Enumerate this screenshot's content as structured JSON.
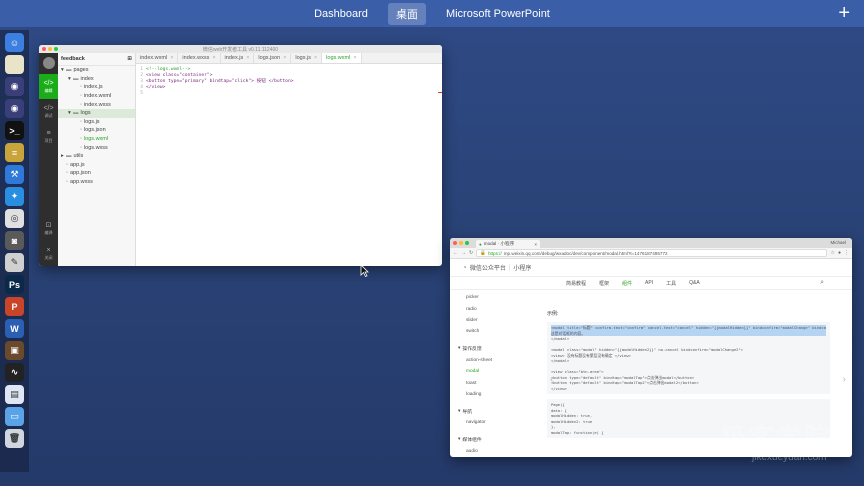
{
  "mission_control": {
    "spaces": [
      "Dashboard",
      "桌面",
      "Microsoft PowerPoint"
    ],
    "active_space_index": 1,
    "add_space_label": "+"
  },
  "dock": {
    "icons": [
      {
        "name": "finder-icon",
        "color": "#3d7fe0",
        "glyph": "☺"
      },
      {
        "name": "notes-icon",
        "color": "#e9e3c8",
        "glyph": ""
      },
      {
        "name": "eclipse-icon",
        "color": "#3a3f7a",
        "glyph": "◉"
      },
      {
        "name": "eclipse-icon-2",
        "color": "#3a3f7a",
        "glyph": "◉"
      },
      {
        "name": "terminal-icon",
        "color": "#111111",
        "glyph": ">_"
      },
      {
        "name": "database-icon",
        "color": "#c9a43a",
        "glyph": "≡"
      },
      {
        "name": "xcode-icon",
        "color": "#2f79d8",
        "glyph": "⚒"
      },
      {
        "name": "safari-icon",
        "color": "#2a8ee0",
        "glyph": "✦"
      },
      {
        "name": "chrome-icon",
        "color": "#e0e0e0",
        "glyph": "◎"
      },
      {
        "name": "photo-booth-icon",
        "color": "#5a5a5a",
        "glyph": "◙"
      },
      {
        "name": "pencil-icon",
        "color": "#d0d0d0",
        "glyph": "✎"
      },
      {
        "name": "photoshop-icon",
        "color": "#0b2a4a",
        "glyph": "Ps"
      },
      {
        "name": "powerpoint-icon",
        "color": "#c9452a",
        "glyph": "P"
      },
      {
        "name": "word-icon",
        "color": "#2b5fb4",
        "glyph": "W"
      },
      {
        "name": "image-app-icon",
        "color": "#6a4a2a",
        "glyph": "▣"
      },
      {
        "name": "activity-monitor-icon",
        "color": "#222222",
        "glyph": "∿"
      },
      {
        "name": "preview-icon",
        "color": "#dfe7f5",
        "glyph": "▤"
      },
      {
        "name": "folder-icon",
        "color": "#5aa3e8",
        "glyph": "▭"
      },
      {
        "name": "trash-icon",
        "color": "#cfd6df",
        "glyph": "🗑"
      }
    ]
  },
  "ide": {
    "window_title": "微信web开发者工具 v0.11.112400",
    "traffic_colors": [
      "#fd5f57",
      "#febb2e",
      "#29c840"
    ],
    "rail": {
      "items": [
        {
          "label": "编辑",
          "icon": "</>",
          "active": true
        },
        {
          "label": "调试",
          "icon": "</>",
          "active": false
        },
        {
          "label": "项目",
          "icon": "≡",
          "active": false
        }
      ],
      "bottom_items": [
        {
          "label": "编译",
          "icon": "⊡"
        },
        {
          "label": "关闭",
          "icon": "×"
        }
      ]
    },
    "project_name": "feedback",
    "tree": [
      {
        "indent": 0,
        "arrow": "▾",
        "type": "folder",
        "name": "pages"
      },
      {
        "indent": 1,
        "arrow": "▾",
        "type": "folder",
        "name": "index"
      },
      {
        "indent": 2,
        "arrow": "",
        "type": "js",
        "name": "index.js"
      },
      {
        "indent": 2,
        "arrow": "",
        "type": "wxml",
        "name": "index.wxml"
      },
      {
        "indent": 2,
        "arrow": "",
        "type": "wxss",
        "name": "index.wxss"
      },
      {
        "indent": 1,
        "arrow": "▾",
        "type": "folder",
        "name": "logs",
        "selected": true
      },
      {
        "indent": 2,
        "arrow": "",
        "type": "js",
        "name": "logs.js"
      },
      {
        "indent": 2,
        "arrow": "",
        "type": "json",
        "name": "logs.json"
      },
      {
        "indent": 2,
        "arrow": "",
        "type": "wxml",
        "name": "logs.wxml",
        "green": true
      },
      {
        "indent": 2,
        "arrow": "",
        "type": "wxss",
        "name": "logs.wxss"
      },
      {
        "indent": 0,
        "arrow": "▸",
        "type": "folder",
        "name": "utils"
      },
      {
        "indent": 0,
        "arrow": "",
        "type": "js",
        "name": "app.js"
      },
      {
        "indent": 0,
        "arrow": "",
        "type": "json",
        "name": "app.json"
      },
      {
        "indent": 0,
        "arrow": "",
        "type": "wxss",
        "name": "app.wxss"
      }
    ],
    "tabs": [
      "index.wxml",
      "index.wxss",
      "index.js",
      "logs.json",
      "logs.js",
      "logs.wxml"
    ],
    "active_tab_index": 5,
    "code_lines": [
      {
        "n": "1",
        "text": "<!--logs.wxml-->"
      },
      {
        "n": "2",
        "text": "<view class=\"container\">"
      },
      {
        "n": "3",
        "text": "  <button type=\"primary\" bindtap=\"click\"> 按钮 </button>"
      },
      {
        "n": "4",
        "text": "</view>"
      },
      {
        "n": "5",
        "text": ""
      }
    ]
  },
  "browser": {
    "tab_title": "modal · 小程序",
    "user": "Michael",
    "url_host": "https://",
    "url_rest": "mp.weixin.qq.com/debug/wxadoc/dev/component/modal.html?t=1476187495772",
    "site_title": "微信公众平台",
    "site_sub": "小程序",
    "nav": [
      "简易教程",
      "框架",
      "组件",
      "API",
      "工具",
      "Q&A"
    ],
    "nav_active_index": 2,
    "sidebar": [
      {
        "kind": "item",
        "label": "picker"
      },
      {
        "kind": "item",
        "label": "radio"
      },
      {
        "kind": "item",
        "label": "slider"
      },
      {
        "kind": "item",
        "label": "switch"
      },
      {
        "kind": "gap"
      },
      {
        "kind": "group",
        "label": "操作反馈"
      },
      {
        "kind": "item",
        "label": "action-sheet"
      },
      {
        "kind": "item",
        "label": "modal",
        "active": true
      },
      {
        "kind": "item",
        "label": "toast"
      },
      {
        "kind": "item",
        "label": "loading"
      },
      {
        "kind": "gap"
      },
      {
        "kind": "group",
        "label": "导航"
      },
      {
        "kind": "item",
        "label": "navigator"
      },
      {
        "kind": "gap"
      },
      {
        "kind": "group",
        "label": "媒体组件"
      },
      {
        "kind": "item",
        "label": "audio"
      }
    ],
    "example_title": "示例:",
    "code_block_1": [
      "<modal title=\"标题\" confirm-text=\"confirm\" cancel-text=\"cancel\" hidden=\"{{modalHidden}}\" bindconfirm=\"modalChange\" bindca",
      "  这是对话框的内容。",
      "</modal>",
      "",
      "<modal class=\"modal\" hidden=\"{{modalHidden2}}\" no-cancel bindconfirm=\"modalChange2\">",
      "  <view> 没有标题没有蒙层没有确定 </view>",
      "</modal>",
      "",
      "<view class=\"btn-area\">",
      "  <button type=\"default\" bindtap=\"modalTap\">点击弹出modal</button>",
      "  <button type=\"default\" bindtap=\"modalTap2\">点击弹出modal2</button>",
      "</view>"
    ],
    "code_block_2": [
      "Page({",
      "  data: {",
      "    modalHidden: true,",
      "    modalHidden2: true",
      "  },",
      "  modalTap: function(e) {"
    ]
  },
  "watermark": {
    "cn": "极客学院",
    "en": "jikexueyuan.com"
  }
}
